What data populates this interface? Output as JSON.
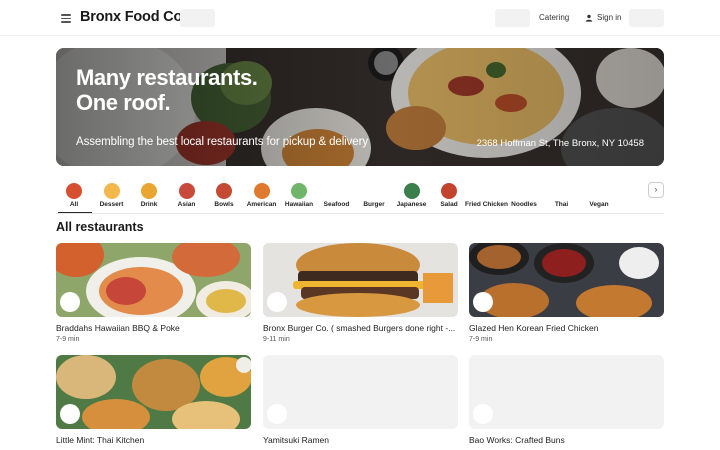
{
  "header": {
    "brand": "Bronx Food Co",
    "catering_label": "Catering",
    "signin_label": "Sign in"
  },
  "hero": {
    "title_line1": "Many restaurants.",
    "title_line2": "One roof.",
    "subtitle": "Assembling the best local restaurants for pickup & delivery",
    "address": "2368 Hoffman St, The Bronx, NY 10458"
  },
  "categories": [
    {
      "label": "All",
      "icon": "all-icon",
      "color": "#d6502f"
    },
    {
      "label": "Dessert",
      "icon": "dessert-icon",
      "color": "#f2b84b"
    },
    {
      "label": "Drink",
      "icon": "drink-icon",
      "color": "#e8a531"
    },
    {
      "label": "Asian",
      "icon": "asian-icon",
      "color": "#c84a3a"
    },
    {
      "label": "Bowls",
      "icon": "bowls-icon",
      "color": "#c44a36"
    },
    {
      "label": "American",
      "icon": "american-icon",
      "color": "#e07a2e"
    },
    {
      "label": "Hawaiian",
      "icon": "hawaiian-icon",
      "color": "#6fb66a"
    },
    {
      "label": "Seafood",
      "icon": "seafood-icon",
      "color": "#ffffff"
    },
    {
      "label": "Burger",
      "icon": "burger-icon",
      "color": "#ffffff"
    },
    {
      "label": "Japanese",
      "icon": "japanese-icon",
      "color": "#3b7f4a"
    },
    {
      "label": "Salad",
      "icon": "salad-icon",
      "color": "#c4432f"
    },
    {
      "label": "Fried Chicken",
      "icon": "fried-chicken-icon",
      "color": "#ffffff"
    },
    {
      "label": "Noodles",
      "icon": "noodles-icon",
      "color": "#ffffff"
    },
    {
      "label": "Thai",
      "icon": "thai-icon",
      "color": "#ffffff"
    },
    {
      "label": "Vegan",
      "icon": "vegan-icon",
      "color": "#ffffff"
    }
  ],
  "section_title": "All restaurants",
  "restaurants": [
    {
      "name": "Braddahs Hawaiian BBQ & Poke",
      "eta": "7-9 min"
    },
    {
      "name": "Bronx Burger Co. ( smashed Burgers done right -...",
      "eta": "9-11 min"
    },
    {
      "name": "Glazed Hen Korean Fried Chicken",
      "eta": "7-9 min"
    },
    {
      "name": "Little Mint: Thai Kitchen",
      "eta": ""
    },
    {
      "name": "Yamitsuki Ramen",
      "eta": ""
    },
    {
      "name": "Bao Works: Crafted Buns",
      "eta": ""
    }
  ]
}
